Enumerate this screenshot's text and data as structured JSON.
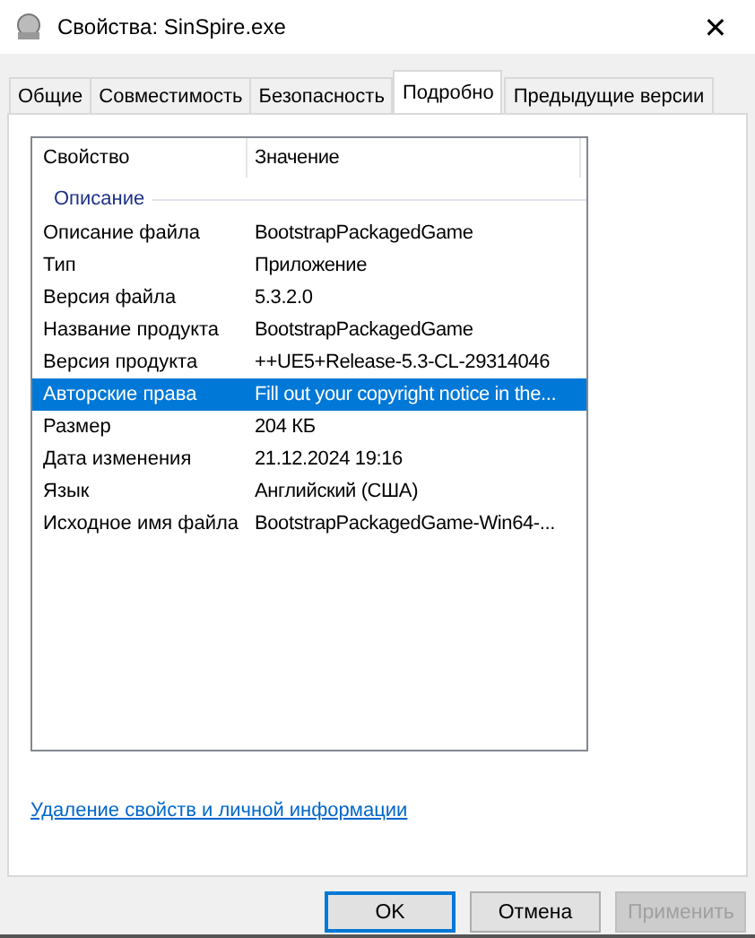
{
  "window": {
    "title": "Свойства: SinSpire.exe",
    "close": "✕"
  },
  "tabs": [
    {
      "label": "Общие",
      "selected": false
    },
    {
      "label": "Совместимость",
      "selected": false
    },
    {
      "label": "Безопасность",
      "selected": false
    },
    {
      "label": "Подробно",
      "selected": true
    },
    {
      "label": "Предыдущие версии",
      "selected": false
    }
  ],
  "table": {
    "columns": [
      "Свойство",
      "Значение"
    ],
    "group": "Описание",
    "rows": [
      {
        "property": "Описание файла",
        "value": "BootstrapPackagedGame",
        "selected": false
      },
      {
        "property": "Тип",
        "value": "Приложение",
        "selected": false
      },
      {
        "property": "Версия файла",
        "value": "5.3.2.0",
        "selected": false
      },
      {
        "property": "Название продукта",
        "value": "BootstrapPackagedGame",
        "selected": false
      },
      {
        "property": "Версия продукта",
        "value": "++UE5+Release-5.3-CL-29314046",
        "selected": false
      },
      {
        "property": "Авторские права",
        "value": "Fill out your copyright notice in the...",
        "selected": true
      },
      {
        "property": "Размер",
        "value": "204 КБ",
        "selected": false
      },
      {
        "property": "Дата изменения",
        "value": "21.12.2024 19:16",
        "selected": false
      },
      {
        "property": "Язык",
        "value": "Английский (США)",
        "selected": false
      },
      {
        "property": "Исходное имя файла",
        "value": "BootstrapPackagedGame-Win64-...",
        "selected": false
      }
    ]
  },
  "link": "Удаление свойств и личной информации",
  "buttons": [
    {
      "label": "OK",
      "default": true,
      "disabled": false
    },
    {
      "label": "Отмена",
      "default": false,
      "disabled": false
    },
    {
      "label": "Применить",
      "default": false,
      "disabled": true
    }
  ]
}
